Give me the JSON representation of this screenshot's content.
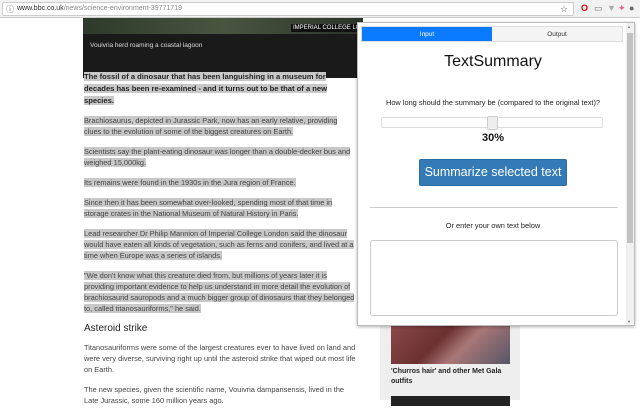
{
  "browser": {
    "url_domain": "www.bbc.co.uk",
    "url_path": "/news/science-environment-39771719"
  },
  "hero": {
    "credit": "IMPERIAL COLLEGE LON",
    "caption": "Vouivria herd roaming a coastal lagoon"
  },
  "article": {
    "lead": "The fossil of a dinosaur that has been languishing in a museum for decades has been re-examined - and it turns out to be that of a new species.",
    "paragraphs": [
      "Brachiosaurus, depicted in Jurassic Park, now has an early relative, providing clues to the evolution of some of the biggest creatures on Earth.",
      "Scientists say the plant-eating dinosaur was longer than a double-decker bus and weighed 15,000kg.",
      "Its remains were found in the 1930s in the Jura region of France.",
      "Since then it has been somewhat over-looked, spending most of that time in storage crates in the National Museum of Natural History in Paris.",
      "Lead researcher Dr Philip Mannion of Imperial College London said the dinosaur would have eaten all kinds of vegetation, such as ferns and conifers, and lived at a time when Europe was a series of islands.",
      "\"We don't know what this creature died from, but millions of years later it is providing important evidence to help us understand in more detail the evolution of brachiosaurid sauropods and a much bigger group of dinosaurs that they belonged to, called titanosauriforms,\" he said."
    ],
    "subheading": "Asteroid strike",
    "after": [
      "Titanosauriforms were some of the largest creatures ever to have lived on land and were very diverse, surviving right up until the asteroid strike that wiped out most life on Earth.",
      "The new species, given the scientific name, Vouivria damparisensis, lived in the Late Jurassic, some 160 million years ago."
    ]
  },
  "sidebar": {
    "caption": "'Churros hair' and other Met Gala outfits"
  },
  "popup": {
    "tabs": [
      {
        "label": "Input"
      },
      {
        "label": "Output"
      }
    ],
    "title": "TextSummary",
    "question": "How long should the summary be (compared to the original text)?",
    "slider_percent": 30,
    "percent_label": "30%",
    "summarize_button": "Summarize selected text",
    "or_label": "Or enter your own text below",
    "textarea_value": ""
  },
  "colors": {
    "active_tab": "#0a7bff",
    "button": "#337ab7"
  }
}
